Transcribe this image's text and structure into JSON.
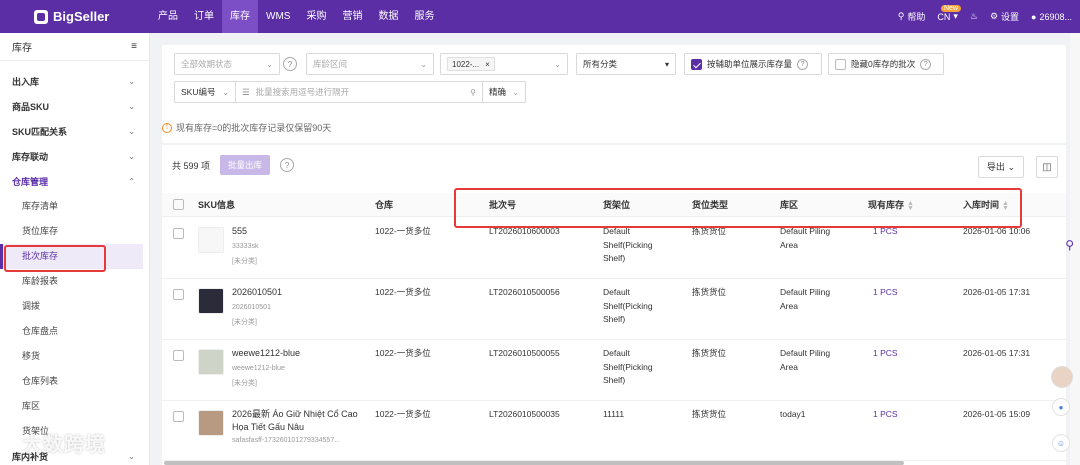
{
  "topnav": {
    "logo": "BigSeller",
    "items": [
      "产品",
      "订单",
      "库存",
      "WMS",
      "采购",
      "营销",
      "数据",
      "服务"
    ],
    "active_index": 2,
    "help": "帮助",
    "lang": "CN",
    "new_badge": "New",
    "settings": "设置",
    "user": "26908..."
  },
  "sidebar": {
    "title": "库存",
    "groups": [
      {
        "label": "出入库"
      },
      {
        "label": "商品SKU"
      },
      {
        "label": "SKU匹配关系"
      },
      {
        "label": "库存联动"
      },
      {
        "label": "仓库管理"
      }
    ],
    "subs": [
      "库存清单",
      "货位库存",
      "批次库存",
      "库龄报表",
      "调拨",
      "仓库盘点",
      "移货",
      "仓库列表",
      "库区",
      "货架位"
    ],
    "active_sub": 2,
    "bottom_group": "库内补货"
  },
  "filters": {
    "expiry_placeholder": "全部效期状态",
    "age_placeholder": "库龄区间",
    "warehouse_tag": "1022-...",
    "category": "所有分类",
    "aux_unit_label": "按辅助单位展示库存量",
    "aux_unit_checked": true,
    "hide_zero_label": "隐藏0库存的批次",
    "hide_zero_checked": false,
    "search_field": "SKU编号",
    "search_placeholder": "批量搜索用逗号进行隔开",
    "match_mode": "精确"
  },
  "notice": "现有库存=0的批次库存记录仅保留90天",
  "table": {
    "total": "共 599 项",
    "batch_out": "批量出库",
    "export": "导出",
    "columns": [
      "SKU信息",
      "仓库",
      "批次号",
      "货架位",
      "货位类型",
      "库区",
      "现有库存",
      "入库时间"
    ],
    "rows": [
      {
        "name": "555",
        "code": "33333sk",
        "cat": "[未分类]",
        "warehouse": "1022-一货多位",
        "batch": "LT2026010600003",
        "shelf": "Default Shelf(Picking Shelf)",
        "loc_type": "拣货货位",
        "zone": "Default Piling Area",
        "stock": "1 PCS",
        "time": "2026-01-06 10:06"
      },
      {
        "name": "2026010501",
        "code": "2026010501",
        "cat": "[未分类]",
        "warehouse": "1022-一货多位",
        "batch": "LT2026010500056",
        "shelf": "Default Shelf(Picking Shelf)",
        "loc_type": "拣货货位",
        "zone": "Default Piling Area",
        "stock": "1 PCS",
        "time": "2026-01-05 17:31"
      },
      {
        "name": "weewe1212-blue",
        "code": "weewe1212-blue",
        "cat": "[未分类]",
        "warehouse": "1022-一货多位",
        "batch": "LT2026010500055",
        "shelf": "Default Shelf(Picking Shelf)",
        "loc_type": "拣货货位",
        "zone": "Default Piling Area",
        "stock": "1 PCS",
        "time": "2026-01-05 17:31"
      },
      {
        "name": "2026最新 Áo Giữ Nhiệt Cổ Cao Họa Tiết Gấu Nâu",
        "code": "safasfasff-173260101279334557...",
        "cat": "",
        "warehouse": "1022-一货多位",
        "batch": "LT2026010500035",
        "shelf": "11111",
        "loc_type": "拣货货位",
        "zone": "today1",
        "stock": "1 PCS",
        "time": "2026-01-05 15:09"
      }
    ]
  },
  "watermark": "大数跨境"
}
